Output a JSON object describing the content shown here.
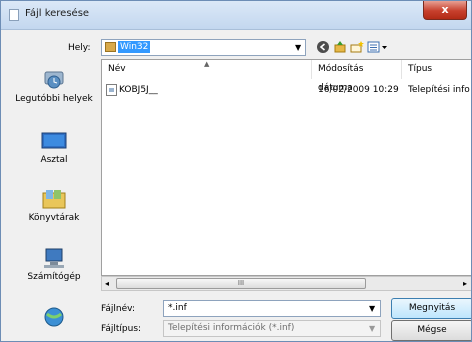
{
  "window": {
    "title": "Fájl keresése",
    "close_glyph": "x"
  },
  "lookin": {
    "label": "Hely:",
    "value": "Win32"
  },
  "toolbar": {
    "icons": [
      "back-icon",
      "up-folder-icon",
      "new-folder-icon",
      "view-menu-icon"
    ]
  },
  "places": [
    {
      "label": "Legutóbbi helyek",
      "icon": "recent-places-icon"
    },
    {
      "label": "Asztal",
      "icon": "desktop-icon"
    },
    {
      "label": "Könyvtárak",
      "icon": "libraries-icon"
    },
    {
      "label": "Számítógép",
      "icon": "computer-icon"
    },
    {
      "label": "",
      "icon": "network-icon"
    }
  ],
  "filelist": {
    "columns": [
      "Név",
      "Módosítás dátuma",
      "Típus"
    ],
    "rows": [
      {
        "name": "KOBJ5J__",
        "modified": "16/02/2009 10:29",
        "type": "Telepítési info"
      }
    ],
    "scroll_grip": "III"
  },
  "form": {
    "filename_label": "Fájlnév:",
    "filename_value": "*.inf",
    "filetype_label": "Fájltípus:",
    "filetype_value": "Telepítési információk (*.inf)",
    "open_button": "Megnyitás",
    "cancel_button": "Mégse"
  }
}
